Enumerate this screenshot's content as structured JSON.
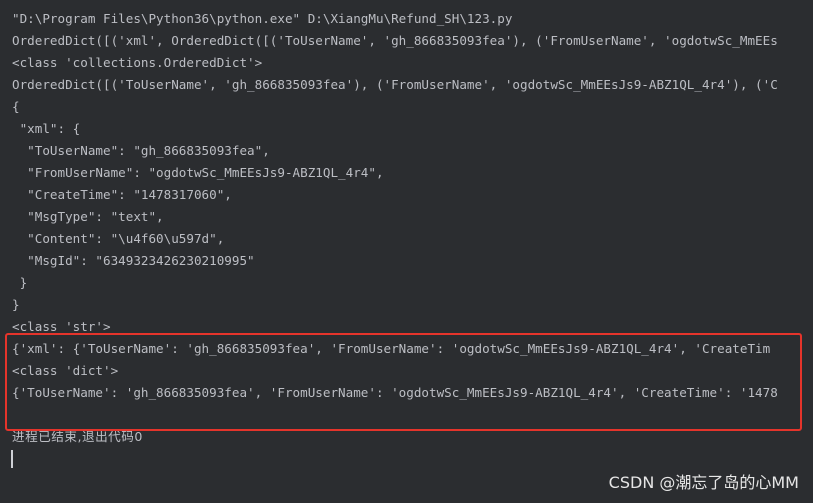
{
  "console": {
    "lines": [
      "\"D:\\Program Files\\Python36\\python.exe\" D:\\XiangMu\\Refund_SH\\123.py",
      "OrderedDict([('xml', OrderedDict([('ToUserName', 'gh_866835093fea'), ('FromUserName', 'ogdotwSc_MmEEs",
      "<class 'collections.OrderedDict'>",
      "OrderedDict([('ToUserName', 'gh_866835093fea'), ('FromUserName', 'ogdotwSc_MmEEsJs9-ABZ1QL_4r4'), ('C",
      "{",
      " \"xml\": {",
      "  \"ToUserName\": \"gh_866835093fea\",",
      "  \"FromUserName\": \"ogdotwSc_MmEEsJs9-ABZ1QL_4r4\",",
      "  \"CreateTime\": \"1478317060\",",
      "  \"MsgType\": \"text\",",
      "  \"Content\": \"\\u4f60\\u597d\",",
      "  \"MsgId\": \"6349323426230210995\"",
      " }",
      "}",
      "<class 'str'>",
      "{'xml': {'ToUserName': 'gh_866835093fea', 'FromUserName': 'ogdotwSc_MmEEsJs9-ABZ1QL_4r4', 'CreateTim",
      "<class 'dict'>",
      "{'ToUserName': 'gh_866835093fea', 'FromUserName': 'ogdotwSc_MmEEsJs9-ABZ1QL_4r4', 'CreateTime': '1478",
      "",
      "进程已结束,退出代码0"
    ]
  },
  "watermark": "CSDN @潮忘了岛的心MM",
  "colors": {
    "background": "#2b2d30",
    "text": "#bcbec4",
    "highlight_border": "#e5342b"
  }
}
